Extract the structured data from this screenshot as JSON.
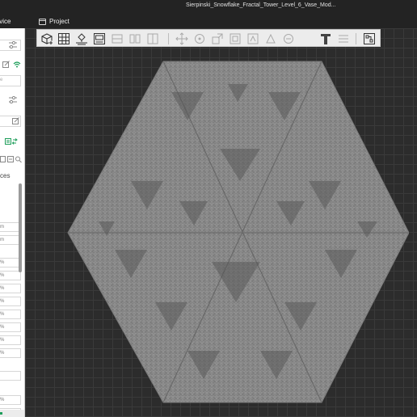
{
  "window": {
    "title": "Sierpinski_Snowflake_Fractal_Tower_Level_6_Vase_Mod..."
  },
  "tabs": {
    "device": "Device",
    "project": "Project"
  },
  "sidebar": {
    "partial_label": "ces",
    "fields": [
      "m",
      "m",
      "%",
      "%",
      "%",
      "%",
      "%",
      "%",
      "%",
      "%",
      "%",
      "%"
    ]
  },
  "toolbar": {
    "buttons": [
      {
        "icon": "add-cube-icon",
        "active": true
      },
      {
        "icon": "grid-arrange-icon",
        "active": true
      },
      {
        "icon": "lay-flat-icon",
        "active": true
      },
      {
        "icon": "auto-orient-icon",
        "active": true
      },
      {
        "icon": "cut-icon",
        "active": false
      },
      {
        "icon": "split-icon",
        "active": false
      },
      {
        "icon": "move-icon",
        "active": false
      },
      {
        "icon": "rotate-icon",
        "active": false
      },
      {
        "icon": "scale-icon",
        "active": false
      },
      {
        "icon": "place-face-icon",
        "active": false
      },
      {
        "icon": "support-paint-icon",
        "active": false
      },
      {
        "icon": "seam-paint-icon",
        "active": false
      },
      {
        "icon": "text-icon",
        "active": true
      },
      {
        "icon": "measure-icon",
        "active": false
      },
      {
        "icon": "assembly-icon",
        "active": true
      }
    ]
  },
  "colors": {
    "viewport_bg": "#2c2c2c",
    "grid": "#3a3a3a",
    "model_light": "#8f8f8f",
    "model_dark": "#5a5a5a",
    "accent_green": "#1e9e5a",
    "toolbar_bg": "#ececec"
  }
}
